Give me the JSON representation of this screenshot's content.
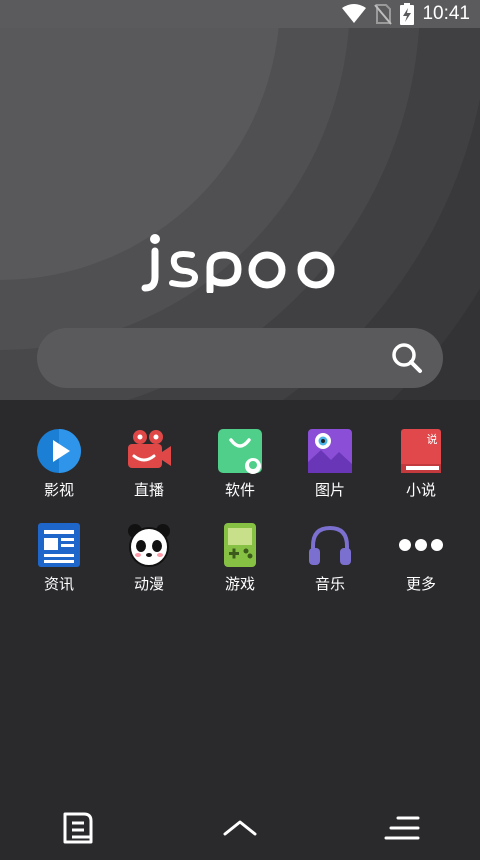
{
  "status_bar": {
    "time": "10:41",
    "icons": [
      "wifi-icon",
      "no-sim-icon",
      "battery-charging-icon"
    ]
  },
  "logo_text": "jspoo",
  "search": {
    "placeholder": ""
  },
  "apps": [
    {
      "label": "影视",
      "icon": "video-play-icon"
    },
    {
      "label": "直播",
      "icon": "live-camera-icon"
    },
    {
      "label": "软件",
      "icon": "app-store-icon"
    },
    {
      "label": "图片",
      "icon": "picture-icon"
    },
    {
      "label": "小说",
      "icon": "novel-book-icon"
    },
    {
      "label": "资讯",
      "icon": "news-icon"
    },
    {
      "label": "动漫",
      "icon": "panda-anime-icon"
    },
    {
      "label": "游戏",
      "icon": "gameboy-icon"
    },
    {
      "label": "音乐",
      "icon": "headphones-icon"
    },
    {
      "label": "更多",
      "icon": "more-dots-icon"
    }
  ],
  "book_badge": "说",
  "navbar": {
    "icons": [
      "bookmark-icon",
      "chevron-up-icon",
      "menu-icon"
    ]
  },
  "colors": {
    "background": "#2a2a2d",
    "status_bar": "#5b5b5e",
    "search_bar": "#5a5a5d"
  }
}
